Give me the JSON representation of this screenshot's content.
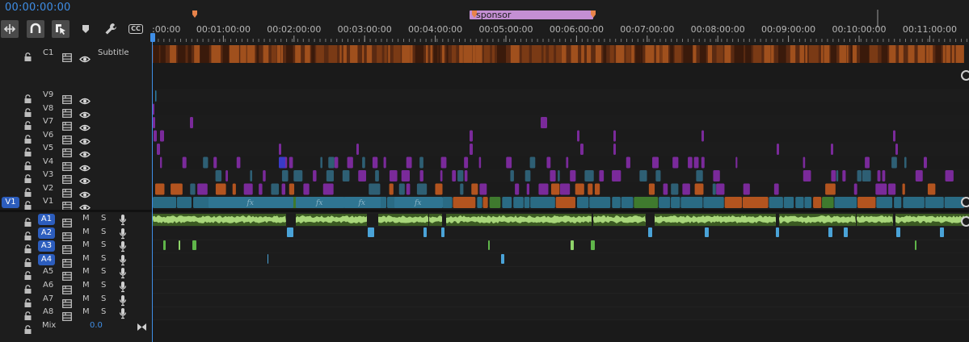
{
  "timecode": "00:00:00:00",
  "colors": {
    "accent": "#3f8ee6",
    "pill": "#2c5dbd",
    "marker": "#e8834a",
    "sponsor": "#c48fd4"
  },
  "toolbar": {
    "icons": [
      "snap-icon",
      "linked-selection-icon",
      "selection-tool-icon",
      "marker-icon",
      "wrench-icon",
      "captions-icon"
    ],
    "cc_label": "CC"
  },
  "ruler": {
    "labels": [
      ":00:00",
      "00:01:00:00",
      "00:02:00:00",
      "00:03:00:00",
      "00:04:00:00",
      "00:05:00:00",
      "00:06:00:00",
      "00:07:00:00",
      "00:08:00:00",
      "00:09:00:00",
      "00:10:00:00",
      "00:11:00:00"
    ],
    "marker_label": "sponsor"
  },
  "tracks": {
    "caption": {
      "name": "C1",
      "label": "Subtitle"
    },
    "video": [
      "V9",
      "V8",
      "V7",
      "V6",
      "V5",
      "V4",
      "V3",
      "V2",
      "V1"
    ],
    "audio": [
      "A1",
      "A2",
      "A3",
      "A4",
      "A5",
      "A6",
      "A7",
      "A8"
    ],
    "source_patch": "V1",
    "audio_targeted": [
      "A1",
      "A2",
      "A3",
      "A4"
    ],
    "mute_label": "M",
    "solo_label": "S",
    "mix": {
      "label": "Mix",
      "value": "0.0"
    }
  }
}
